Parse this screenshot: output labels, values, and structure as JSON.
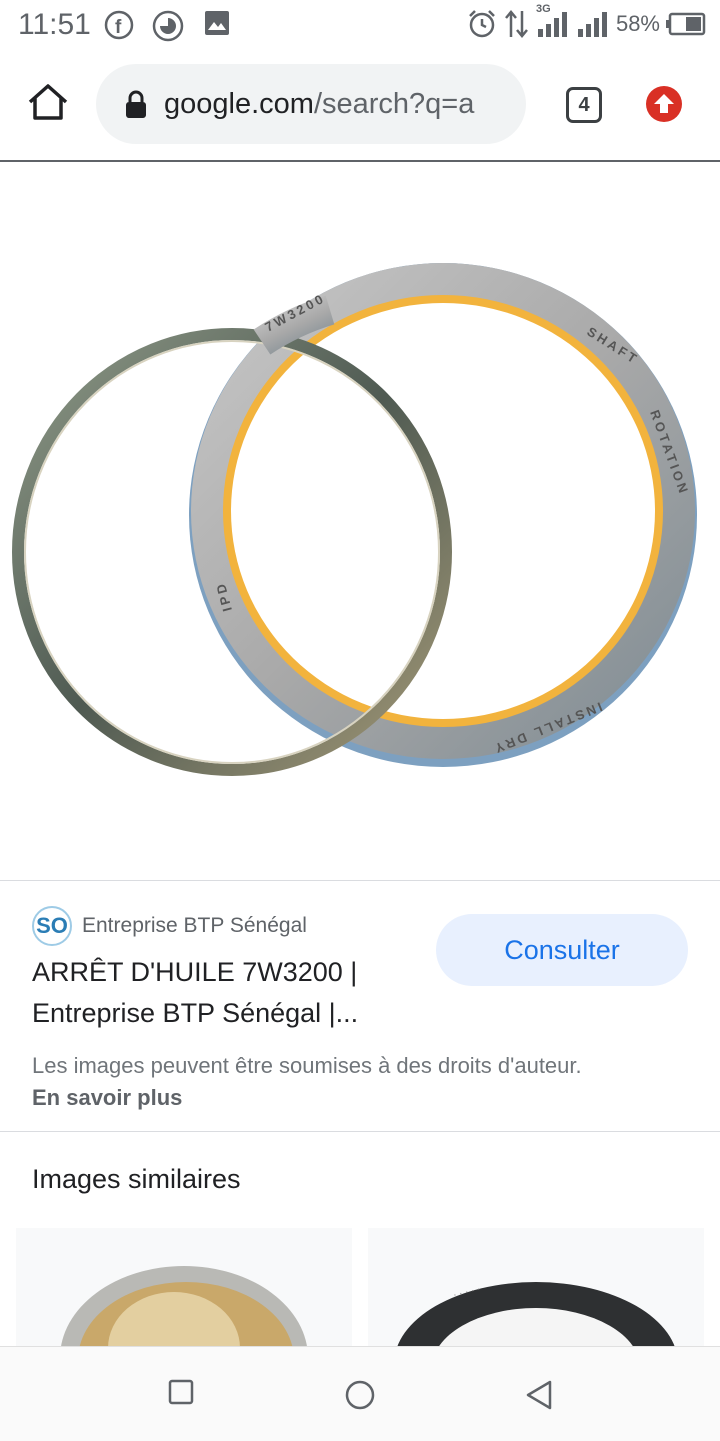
{
  "status_bar": {
    "time": "11:51",
    "battery": "58%",
    "network": "3G",
    "icons": [
      "facebook-icon",
      "pie-chart-icon",
      "gallery-icon",
      "alarm-icon",
      "data-transfer-icon",
      "signal-icon",
      "battery-icon"
    ]
  },
  "browser": {
    "url_host": "google.com",
    "url_path": "/search?q=a",
    "tab_count": "4"
  },
  "result": {
    "source_logo_text": "SO",
    "source_name": "Entreprise BTP Sénégal",
    "visit_button": "Consulter",
    "title_line1": "ARRÊT D'HUILE 7W3200 |",
    "title_line2": "Entreprise BTP Sénégal |...",
    "rights_text": "Les images peuvent être soumises à des droits d'auteur.",
    "learn_more": "En savoir plus"
  },
  "image_text": {
    "part_number": "7W3200",
    "shaft": "SHAFT",
    "rotation": "ROTATION",
    "install": "INSTALL DRY",
    "brand": "IPD"
  },
  "similar": {
    "heading": "Images similaires"
  },
  "colors": {
    "accent": "#1a73e8",
    "seal_yellow": "#f2b33d",
    "update_red": "#d93025"
  }
}
